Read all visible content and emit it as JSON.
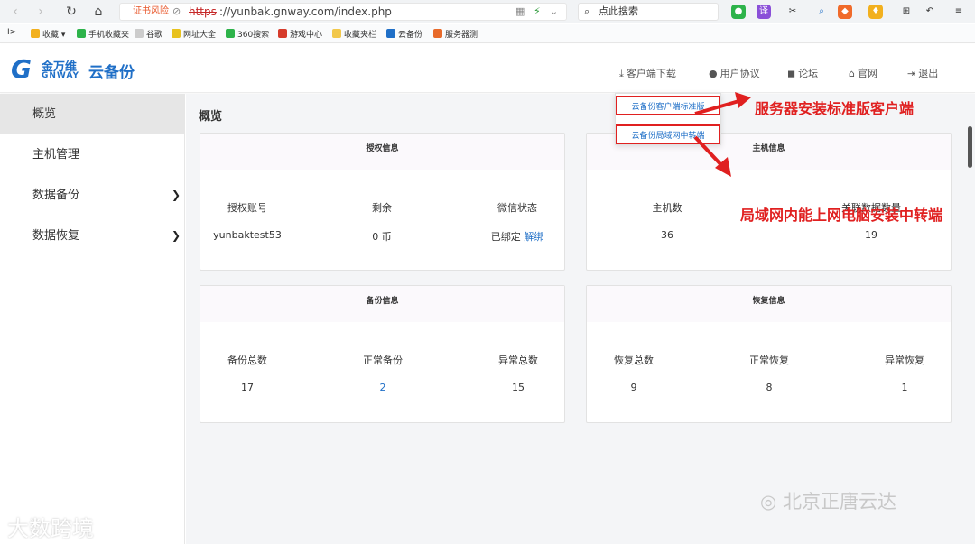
{
  "browser": {
    "cert_warning": "证书风险",
    "url_scheme": "https",
    "url_rest": "://yunbak.gnway.com/index.php",
    "search_placeholder": "点此搜索"
  },
  "bookmarks": [
    "收藏",
    "手机收藏夹",
    "谷歌",
    "网址大全",
    "360搜索",
    "游戏中心",
    "收藏夹栏",
    "云备份",
    "服务器测"
  ],
  "header": {
    "brand_cn": "金万维",
    "brand_en": "GNWAY",
    "product": "云备份",
    "nav": [
      "客户端下载",
      "用户协议",
      "论坛",
      "官网",
      "退出"
    ]
  },
  "dropdown": [
    "云备份客户端标准版",
    "云备份局域网中转端"
  ],
  "sidebar": [
    "概览",
    "主机管理",
    "数据备份",
    "数据恢复"
  ],
  "page_title": "概览",
  "cards": {
    "auth": {
      "title": "授权信息",
      "labels": [
        "授权账号",
        "剩余",
        "微信状态"
      ],
      "values": [
        "yunbaktest53",
        "0 币",
        "已绑定"
      ],
      "unbind": "解绑"
    },
    "host": {
      "title": "主机信息",
      "labels": [
        "主机数",
        "关联数据数量"
      ],
      "values": [
        "36",
        "19"
      ]
    },
    "backup": {
      "title": "备份信息",
      "labels": [
        "备份总数",
        "正常备份",
        "异常总数"
      ],
      "values": [
        "17",
        "2",
        "15"
      ]
    },
    "restore": {
      "title": "恢复信息",
      "labels": [
        "恢复总数",
        "正常恢复",
        "异常恢复"
      ],
      "values": [
        "9",
        "8",
        "1"
      ]
    }
  },
  "annotations": [
    "服务器安装标准版客户端",
    "局域网内能上网电脑安装中转端"
  ],
  "watermarks": [
    "北京正唐云达",
    "大数跨境"
  ],
  "colors": {
    "accent": "#1f6fc7",
    "annotation": "#e02020"
  }
}
